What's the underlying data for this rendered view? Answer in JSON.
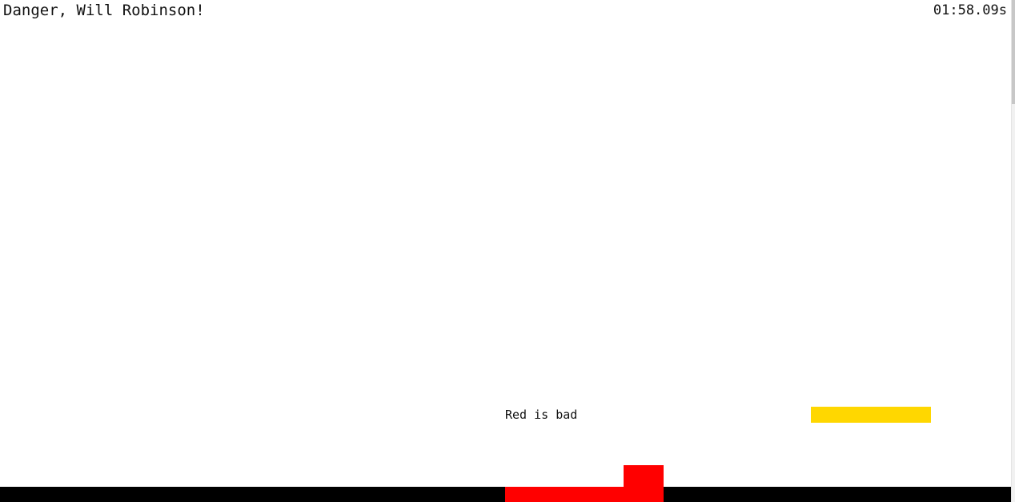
{
  "hud": {
    "title": "Danger, Will Robinson!",
    "timer": "01:58.09s"
  },
  "hint": {
    "text": "Red is bad"
  },
  "colors": {
    "ground": "#000000",
    "hazard": "#ff0000",
    "platform": "#ffd700",
    "background": "#ffffff",
    "text": "#111111"
  },
  "icons": {
    "player": "yellow-bar",
    "hazard": "red-block"
  }
}
